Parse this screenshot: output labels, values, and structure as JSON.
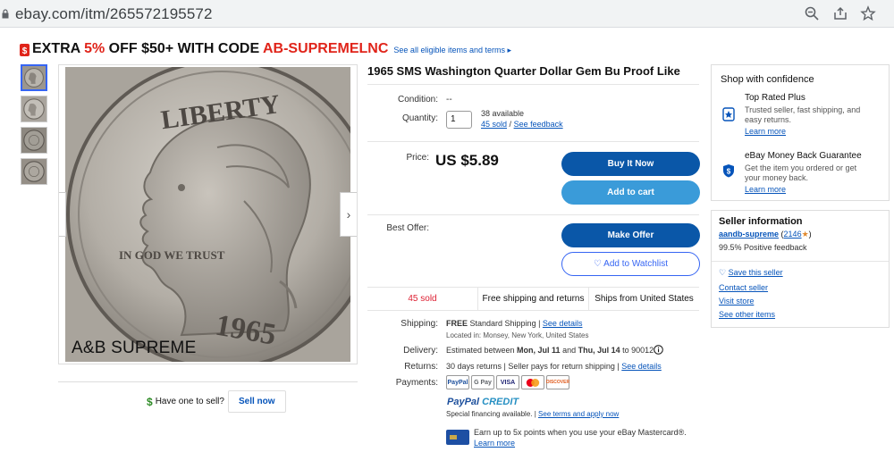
{
  "browser": {
    "url": "ebay.com/itm/265572195572"
  },
  "promo": {
    "text_before": "EXTRA ",
    "percent": "5%",
    "text_after": " OFF $50+ WITH CODE ",
    "code": "AB-SUPREMELNC",
    "link": "See all eligible items and terms ▸"
  },
  "gallery": {
    "watermark": "A&B SUPREME",
    "coin": {
      "top_text": "LIBERTY",
      "motto": "IN GOD WE TRUST",
      "year": "1965"
    }
  },
  "sell": {
    "question": "Have one to sell?",
    "button": "Sell now"
  },
  "item": {
    "title": "1965 SMS Washington Quarter Dollar Gem Bu Proof Like",
    "condition_label": "Condition:",
    "condition_value": "--",
    "quantity_label": "Quantity:",
    "quantity_value": "1",
    "available": "38 available",
    "sold_link": "45 sold",
    "separator": "/",
    "feedback_link": "See feedback",
    "price_label": "Price:",
    "price": "US $5.89",
    "buy_now": "Buy It Now",
    "add_to_cart": "Add to cart",
    "best_offer_label": "Best Offer:",
    "make_offer": "Make Offer",
    "watchlist": "♡ Add to Watchlist",
    "stats": [
      "45 sold",
      "Free shipping and returns",
      "Ships from United States"
    ],
    "shipping_label": "Shipping:",
    "shipping_strong": "FREE",
    "shipping_text": " Standard Shipping | ",
    "shipping_link": "See details",
    "located": "Located in: Monsey, New York, United States",
    "delivery_label": "Delivery:",
    "delivery_prefix": "Estimated between ",
    "delivery_d1": "Mon, Jul 11",
    "delivery_and": " and ",
    "delivery_d2": "Thu, Jul 14",
    "delivery_suffix": " to 90012",
    "returns_label": "Returns:",
    "returns_text": "30 days returns | Seller pays for return shipping | ",
    "returns_link": "See details",
    "payments_label": "Payments:",
    "payment_methods": [
      "PayPal",
      "G Pay",
      "VISA",
      "",
      "DISCOVER"
    ],
    "paypal_credit_1": "PayPal",
    "paypal_credit_2": " CREDIT",
    "financing": "Special financing available. | ",
    "financing_link": "See terms and apply now",
    "mastercard_text": "Earn up to 5x points when you use your eBay Mastercard®.",
    "mastercard_link": "Learn more"
  },
  "confidence": {
    "heading": "Shop with confidence",
    "trs_title": "Top Rated Plus",
    "trs_desc_1": "Trusted seller, fast shipping, and",
    "trs_desc_2": "easy returns.",
    "trs_link": "Learn more",
    "mbg_title": "eBay Money Back Guarantee",
    "mbg_desc_1": "Get the item you ordered or get",
    "mbg_desc_2": "your money back.",
    "mbg_link": "Learn more"
  },
  "seller": {
    "heading": "Seller information",
    "name": "aandb-supreme",
    "score": "2146",
    "positive": "99.5% Positive feedback",
    "save": "Save this seller",
    "contact": "Contact seller",
    "store": "Visit store",
    "other": "See other items"
  },
  "colors": {
    "primary_blue": "#0654ba",
    "buy_now": "#0a57a8",
    "add_to_cart": "#3a9bd9",
    "promo_red": "#e0241a",
    "sold_red": "#dd1e31"
  }
}
